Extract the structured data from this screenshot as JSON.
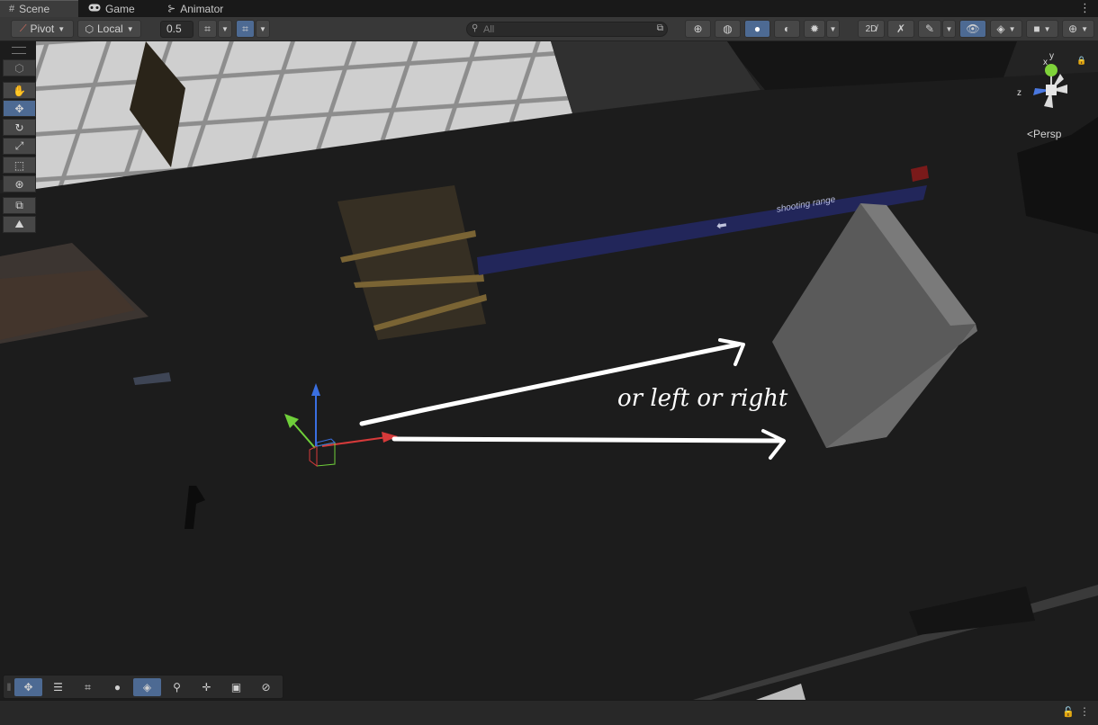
{
  "tabs": [
    {
      "label": "Scene",
      "icon": "grid-icon",
      "active": true
    },
    {
      "label": "Game",
      "icon": "gamepad-icon",
      "active": false
    },
    {
      "label": "Animator",
      "icon": "animator-icon",
      "active": false
    }
  ],
  "toolbar": {
    "pivot_label": "Pivot",
    "local_label": "Local",
    "snap_value": "0.5",
    "search_placeholder": "All"
  },
  "scene": {
    "sign_text": "shooting range",
    "annotation_text": "or left or right",
    "view_mode_label": "Persp",
    "gizmo_axes": [
      "y",
      "x",
      "z"
    ]
  },
  "colors": {
    "accent": "#4d6a93",
    "axis_x": "#d63a3a",
    "axis_y": "#3a6fe0",
    "axis_z": "#6fcf3a"
  }
}
